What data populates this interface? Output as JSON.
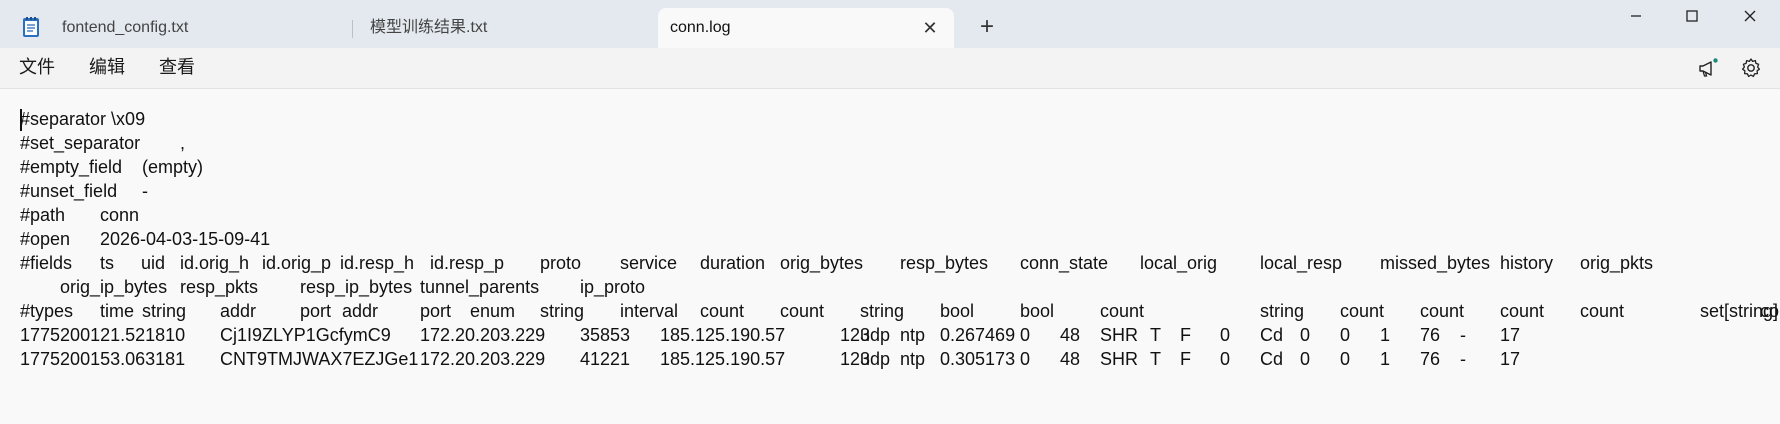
{
  "window": {
    "tabs": [
      {
        "label": "fontend_config.txt",
        "active": false
      },
      {
        "label": "模型训练结果.txt",
        "active": false
      },
      {
        "label": "conn.log",
        "active": true
      }
    ]
  },
  "menu": {
    "items": [
      "文件",
      "编辑",
      "查看"
    ]
  },
  "icons": {
    "app": "notepad-icon",
    "close_tab": "close-icon",
    "new_tab": "plus-icon",
    "minimize": "minimize-icon",
    "maximize": "maximize-icon",
    "close_window": "close-window-icon",
    "announce": "megaphone-icon",
    "settings": "gear-icon"
  },
  "colors": {
    "titlebar": "#e3e9ee",
    "editor_bg": "#f9f9f9",
    "notification_dot": "#1a8a7a"
  },
  "document": {
    "lines": [
      [
        "#separator \\x09"
      ],
      [
        "#set_separator",
        ","
      ],
      [
        "#empty_field",
        "(empty)"
      ],
      [
        "#unset_field",
        "-"
      ],
      [
        "#path",
        "conn"
      ],
      [
        "#open",
        "2026-04-03-15-09-41"
      ],
      [
        "#fields",
        "ts",
        "uid",
        "id.orig_h",
        "id.orig_p",
        "id.resp_h",
        "id.resp_p",
        "proto",
        "service",
        "duration",
        "orig_bytes",
        "resp_bytes",
        "conn_state",
        "local_orig",
        "local_resp",
        "missed_bytes",
        "history",
        "orig_pkts"
      ],
      [
        "orig_ip_bytes",
        "resp_pkts",
        "resp_ip_bytes",
        "tunnel_parents",
        "ip_proto"
      ],
      [
        "#types",
        "time",
        "string",
        "addr",
        "port",
        "addr",
        "port",
        "enum",
        "string",
        "interval",
        "count",
        "count",
        "string",
        "bool",
        "bool",
        "count",
        "string",
        "count",
        "count",
        "count",
        "count",
        "set[string]",
        "count"
      ],
      [
        "1775200121.521810",
        "Cj1I9ZLYP1GcfymC9",
        "172.20.203.229",
        "35853",
        "185.125.190.57",
        "123",
        "udp",
        "ntp",
        "0.267469",
        "0",
        "48",
        "SHR",
        "T",
        "F",
        "0",
        "Cd",
        "0",
        "0",
        "1",
        "76",
        "-",
        "17"
      ],
      [
        "1775200153.063181",
        "CNT9TMJWAX7EZJGe1",
        "172.20.203.229",
        "41221",
        "185.125.190.57",
        "123",
        "udp",
        "ntp",
        "0.305173",
        "0",
        "48",
        "SHR",
        "T",
        "F",
        "0",
        "Cd",
        "0",
        "0",
        "1",
        "76",
        "-",
        "17"
      ]
    ]
  }
}
